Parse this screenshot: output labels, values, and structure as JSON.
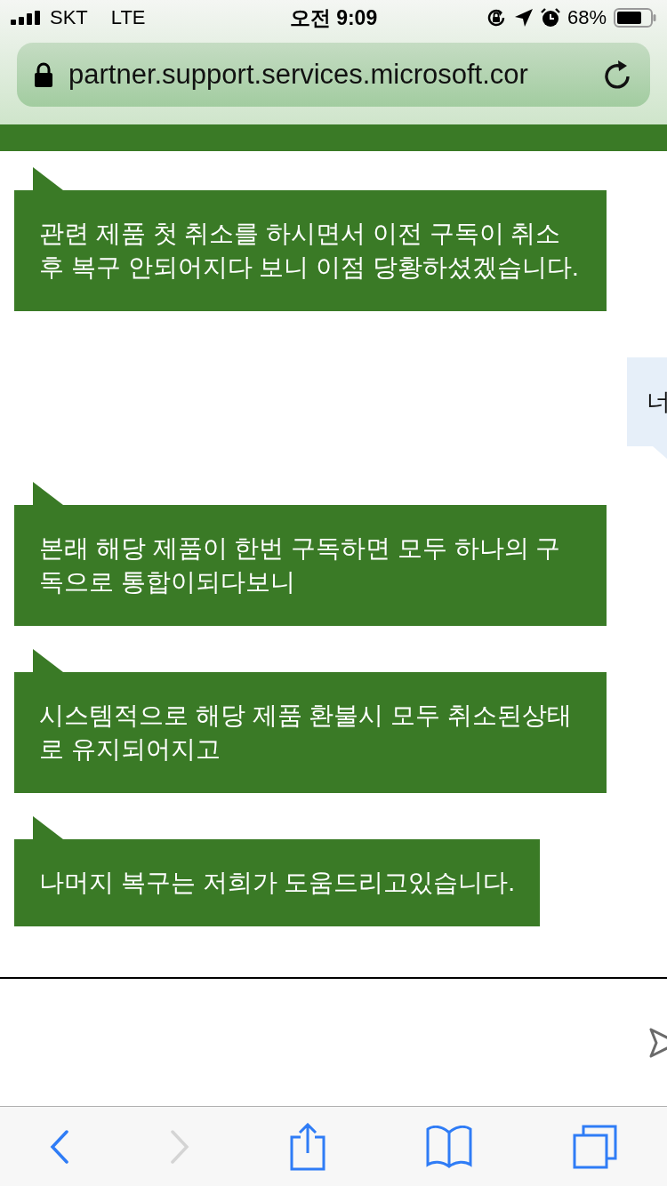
{
  "status_bar": {
    "carrier": "SKT",
    "network": "LTE",
    "time": "오전 9:09",
    "battery": "68%"
  },
  "address_bar": {
    "url": "partner.support.services.microsoft.cor"
  },
  "messages": [
    {
      "kind": "agent",
      "text": "관련 제품 첫 취소를 하시면서 이전 구독이 취소 후 복구 안되어지다 보니 이점 당황하셨겠습니다."
    },
    {
      "kind": "user",
      "text": "너"
    },
    {
      "kind": "agent",
      "text": "본래 해당 제품이 한번 구독하면 모두 하나의 구독으로 통합이되다보니"
    },
    {
      "kind": "agent",
      "text": "시스템적으로 해당 제품 환불시 모두 취소된상태로 유지되어지고"
    },
    {
      "kind": "agent",
      "text": "나머지 복구는 저희가 도움드리고있습니다."
    }
  ]
}
